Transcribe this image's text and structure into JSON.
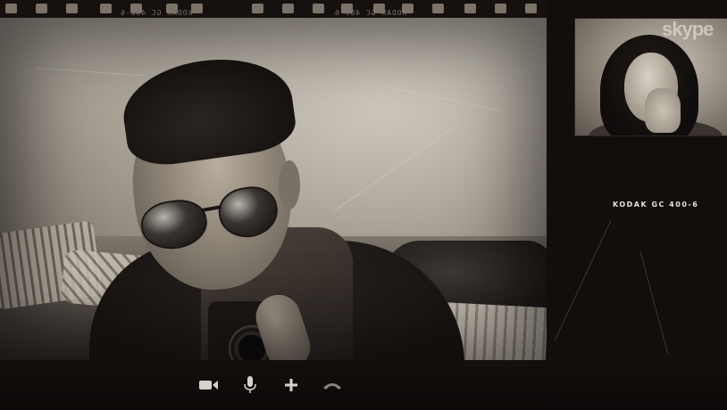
{
  "window": {
    "app_logo_text": "skype",
    "film_edge_text": "KODAK GC 400-6",
    "right_panel_label": "KODAK GC 400-6"
  },
  "controls": [
    {
      "name": "video-camera",
      "icon": "video-camera-icon"
    },
    {
      "name": "microphone",
      "icon": "microphone-icon"
    },
    {
      "name": "add",
      "icon": "plus-icon"
    },
    {
      "name": "end-call",
      "icon": "hang-up-icon"
    }
  ],
  "colors": {
    "frame": "#0c0908",
    "icon": "#d8d2c8",
    "end_call_icon": "#8a837a"
  }
}
